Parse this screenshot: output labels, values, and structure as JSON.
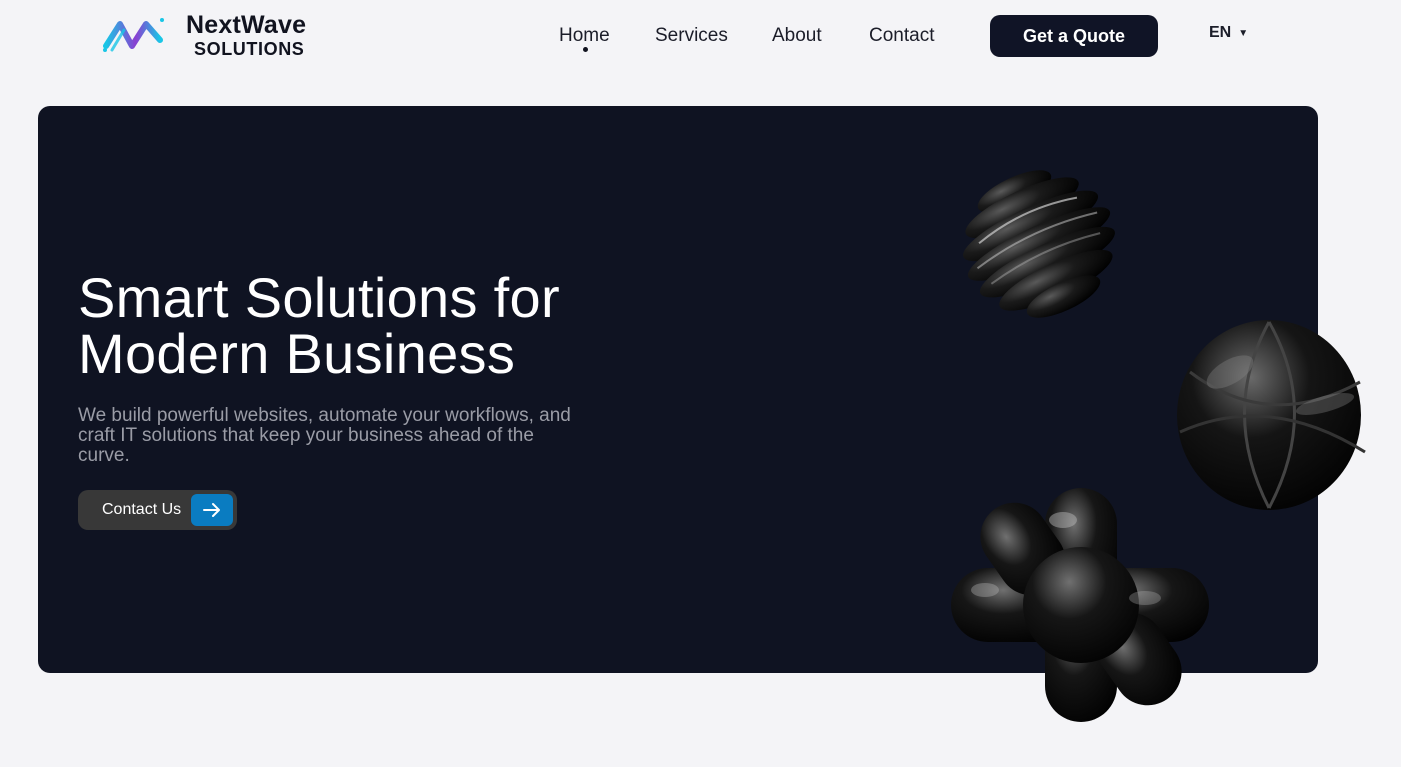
{
  "brand": {
    "name": "NextWave",
    "tagline": "SOLUTIONS",
    "logo_icon": "wave-n-logo-icon",
    "colors": {
      "cyan": "#19c6e6",
      "purple": "#8a3fd1"
    }
  },
  "nav": {
    "items": [
      {
        "label": "Home",
        "active": true
      },
      {
        "label": "Services",
        "active": false
      },
      {
        "label": "About",
        "active": false
      },
      {
        "label": "Contact",
        "active": false
      }
    ]
  },
  "header": {
    "quote_label": "Get a Quote",
    "language": "EN",
    "language_icon": "caret-down-icon"
  },
  "hero": {
    "title_line1": "Smart Solutions for",
    "title_line2": "Modern Business",
    "subtitle_line1": "We build powerful websites, automate your workflows, and",
    "subtitle_line2": "craft IT solutions that keep your business ahead of the",
    "subtitle_line3": "curve.",
    "cta_label": "Contact Us",
    "cta_icon": "arrow-right-icon"
  },
  "colors": {
    "page_bg": "#f4f4f7",
    "hero_bg": "#0f1322",
    "button_dark": "#101426",
    "cta_bg": "#383838",
    "cta_accent": "#0a7cc1"
  }
}
